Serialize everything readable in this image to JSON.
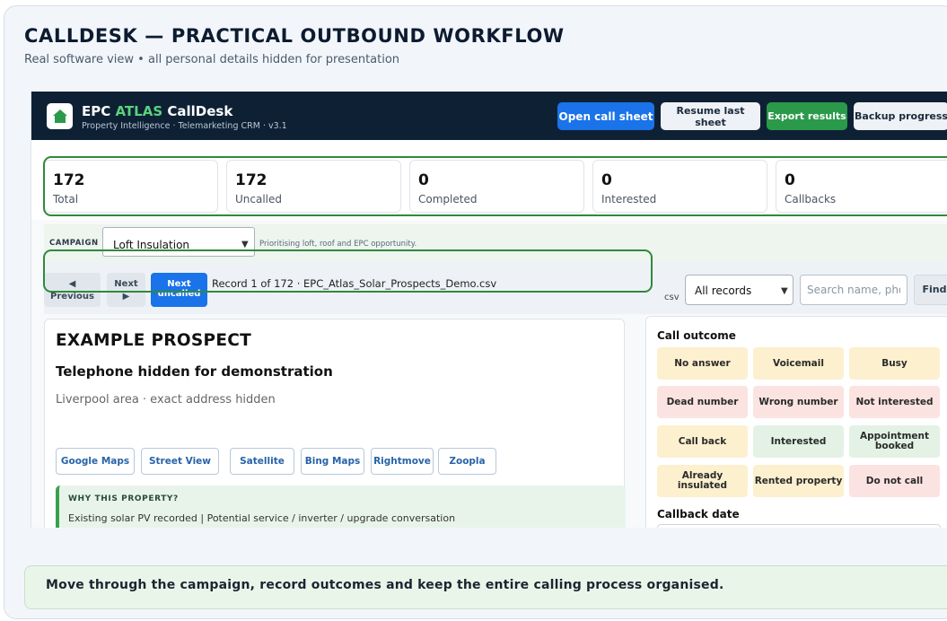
{
  "page": {
    "title": "CALLDESK — PRACTICAL OUTBOUND WORKFLOW",
    "subtitle": "Real software view • all personal details hidden for presentation",
    "footer": "Move through the campaign, record outcomes and keep the entire calling process organised."
  },
  "app": {
    "brand_prefix": "EPC ",
    "brand_accent": "ATLAS",
    "brand_suffix": " CallDesk",
    "subtitle": "Property Intelligence · Telemarketing CRM · v3.1",
    "accent_color": "#5bd17d",
    "logo_icon": "house-icon"
  },
  "toolbar": {
    "open_call_sheet": "Open call sheet",
    "resume_last_sheet": "Resume last sheet",
    "export_results": "Export results",
    "backup_progress": "Backup progress"
  },
  "stats": [
    {
      "value": "172",
      "label": "Total"
    },
    {
      "value": "172",
      "label": "Uncalled"
    },
    {
      "value": "0",
      "label": "Completed"
    },
    {
      "value": "0",
      "label": "Interested"
    },
    {
      "value": "0",
      "label": "Callbacks"
    }
  ],
  "campaign": {
    "label": "CAMPAIGN",
    "selected": "Loft Insulation",
    "hint": "Prioritising loft, roof and EPC opportunity."
  },
  "navigation": {
    "previous_arrow": "◀",
    "previous_label": "Previous",
    "next_label": "Next",
    "next_arrow": "▶",
    "next_uncalled_l1": "Next",
    "next_uncalled_l2": "uncalled",
    "record_info": "Record 1 of 172 · EPC_Atlas_Solar_Prospects_Demo.csv",
    "csv_label": "csv",
    "filter_selected": "All records",
    "search_placeholder": "Search name, phon",
    "find_label": "Find"
  },
  "prospect": {
    "name": "EXAMPLE PROSPECT",
    "phone": "Telephone hidden for demonstration",
    "area": "Liverpool area · exact address hidden",
    "map_links": [
      "Google Maps",
      "Street View",
      "Satellite",
      "Bing Maps",
      "Rightmove",
      "Zoopla"
    ],
    "why_title": "WHY THIS PROPERTY?",
    "why_text": "Existing solar PV recorded | Potential service / inverter / upgrade conversation"
  },
  "outcomes": {
    "title": "Call outcome",
    "buttons": [
      {
        "label": "No answer",
        "tone": "amber"
      },
      {
        "label": "Voicemail",
        "tone": "amber"
      },
      {
        "label": "Busy",
        "tone": "amber"
      },
      {
        "label": "Dead number",
        "tone": "red"
      },
      {
        "label": "Wrong number",
        "tone": "red"
      },
      {
        "label": "Not interested",
        "tone": "red"
      },
      {
        "label": "Call back",
        "tone": "amber"
      },
      {
        "label": "Interested",
        "tone": "green"
      },
      {
        "label": "Appointment booked",
        "tone": "green"
      },
      {
        "label": "Already insulated",
        "tone": "amber"
      },
      {
        "label": "Rented property",
        "tone": "amber"
      },
      {
        "label": "Do not call",
        "tone": "red"
      }
    ],
    "callback_title": "Callback date"
  }
}
